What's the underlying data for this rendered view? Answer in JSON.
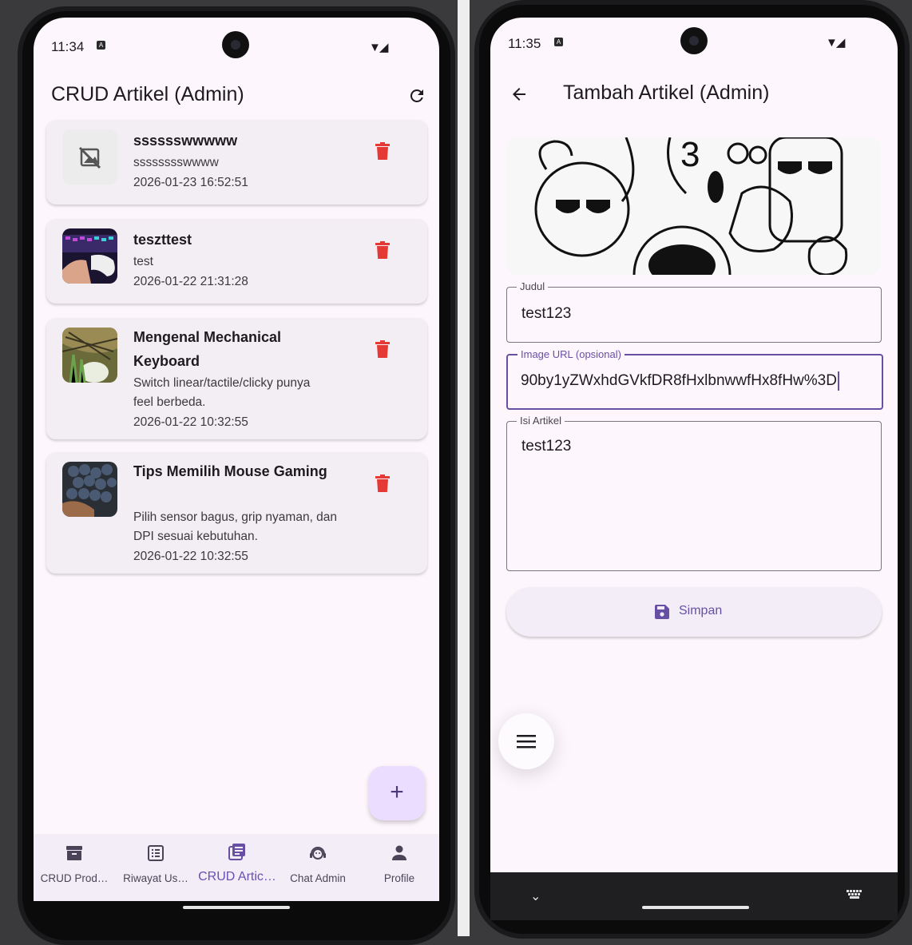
{
  "left_screen": {
    "status": {
      "time": "11:34"
    },
    "appbar": {
      "title": "CRUD Artikel (Admin)"
    },
    "articles": [
      {
        "title": "sssssswwwww",
        "content": "sssssssswwww",
        "date": "2026-01-23 16:52:51",
        "thumb": "no-image-icon"
      },
      {
        "title": "teszttest",
        "content": "test",
        "date": "2026-01-22 21:31:28",
        "thumb": "gaming-keyboard-photo"
      },
      {
        "title": "Mengenal Mechanical Keyboard",
        "content": "Switch linear/tactile/clicky punya feel berbeda.",
        "date": "2026-01-22 10:32:55",
        "thumb": "plant-photo"
      },
      {
        "title": "Tips Memilih Mouse Gaming",
        "content": "Pilih sensor bagus, grip nyaman, dan DPI sesuai kebutuhan.",
        "date": "2026-01-22 10:32:55",
        "thumb": "grapes-photo"
      }
    ],
    "fab_label": "+",
    "nav": [
      {
        "label": "CRUD Prod…",
        "icon": "archive-icon"
      },
      {
        "label": "Riwayat Us…",
        "icon": "list-icon"
      },
      {
        "label": "CRUD Artic…",
        "icon": "article-icon",
        "active": true
      },
      {
        "label": "Chat Admin",
        "icon": "support-agent-icon"
      },
      {
        "label": "Profile",
        "icon": "person-icon"
      }
    ]
  },
  "right_screen": {
    "status": {
      "time": "11:35"
    },
    "appbar": {
      "title": "Tambah Artikel (Admin)"
    },
    "form": {
      "judul_label": "Judul",
      "judul_value": "test123",
      "image_url_label": "Image URL (opsional)",
      "image_url_value": "90by1yZWxhdGVkfDR8fHxlbnwwfHx8fHw%3D",
      "isi_label": "Isi Artikel",
      "isi_value": "test123",
      "save_label": "Simpan"
    }
  },
  "colors": {
    "accent": "#6750a4",
    "danger": "#e53935",
    "fab": "#eaddff",
    "background": "#fdf7fd"
  }
}
